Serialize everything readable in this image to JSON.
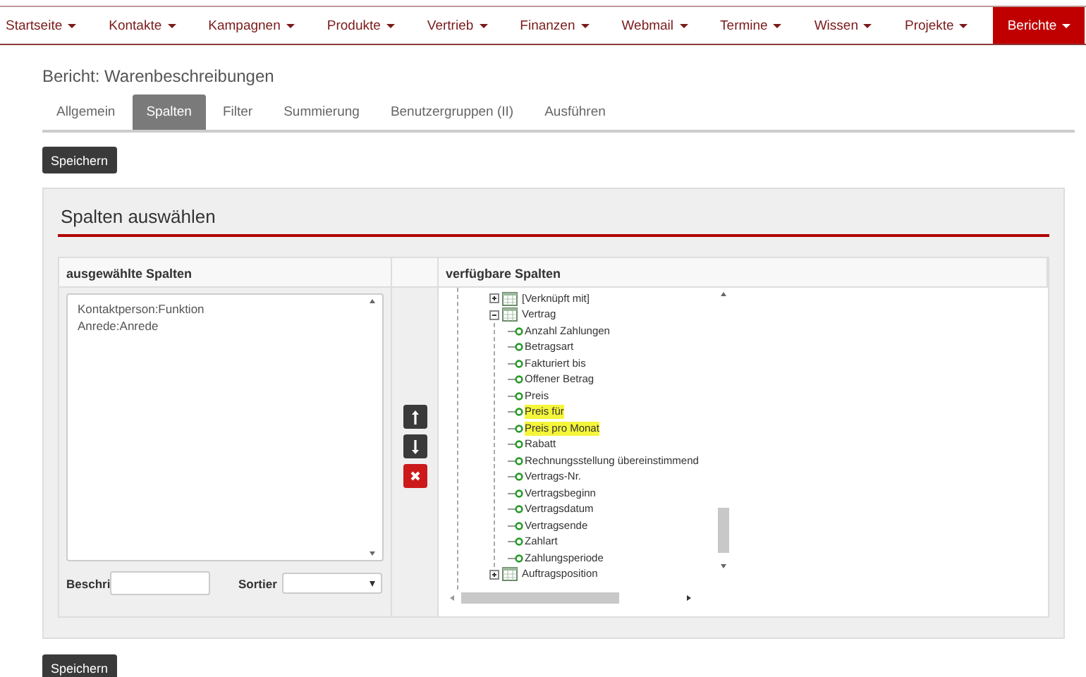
{
  "nav": [
    {
      "label": "Startseite",
      "selected": false
    },
    {
      "label": "Kontakte",
      "selected": false
    },
    {
      "label": "Kampagnen",
      "selected": false
    },
    {
      "label": "Produkte",
      "selected": false
    },
    {
      "label": "Vertrieb",
      "selected": false
    },
    {
      "label": "Finanzen",
      "selected": false
    },
    {
      "label": "Webmail",
      "selected": false
    },
    {
      "label": "Termine",
      "selected": false
    },
    {
      "label": "Wissen",
      "selected": false
    },
    {
      "label": "Projekte",
      "selected": false
    },
    {
      "label": "Berichte",
      "selected": true
    }
  ],
  "page_title": "Bericht: Warenbeschreibungen",
  "tabs": [
    {
      "label": "Allgemein",
      "selected": false
    },
    {
      "label": "Spalten",
      "selected": true
    },
    {
      "label": "Filter",
      "selected": false
    },
    {
      "label": "Summierung",
      "selected": false
    },
    {
      "label": "Benutzergruppen (II)",
      "selected": false
    },
    {
      "label": "Ausführen",
      "selected": false
    }
  ],
  "save_button_top": "Speichern",
  "panel": {
    "title": "Spalten auswählen",
    "selected_header": "ausgewählte Spalten",
    "available_header": "verfügbare Spalten",
    "selected_columns": [
      "Kontaktperson:Funktion",
      "Anrede:Anrede"
    ],
    "caption_label": "Beschri",
    "sort_label": "Sortier",
    "tree": [
      {
        "kind": "folder",
        "label": "[Verknüpft mit]",
        "expanded": false
      },
      {
        "kind": "folder",
        "label": "Vertrag",
        "expanded": true,
        "children": [
          {
            "kind": "field",
            "label": "Anzahl Zahlungen",
            "highlighted": false
          },
          {
            "kind": "field",
            "label": "Betragsart",
            "highlighted": false
          },
          {
            "kind": "field",
            "label": "Fakturiert bis",
            "highlighted": false
          },
          {
            "kind": "field",
            "label": "Offener Betrag",
            "highlighted": false
          },
          {
            "kind": "field",
            "label": "Preis",
            "highlighted": false
          },
          {
            "kind": "field",
            "label": "Preis für",
            "highlighted": true
          },
          {
            "kind": "field",
            "label": "Preis pro Monat",
            "highlighted": true
          },
          {
            "kind": "field",
            "label": "Rabatt",
            "highlighted": false
          },
          {
            "kind": "field",
            "label": "Rechnungsstellung übereinstimmend",
            "highlighted": false
          },
          {
            "kind": "field",
            "label": "Vertrags-Nr.",
            "highlighted": false
          },
          {
            "kind": "field",
            "label": "Vertragsbeginn",
            "highlighted": false
          },
          {
            "kind": "field",
            "label": "Vertragsdatum",
            "highlighted": false
          },
          {
            "kind": "field",
            "label": "Vertragsende",
            "highlighted": false
          },
          {
            "kind": "field",
            "label": "Zahlart",
            "highlighted": false
          },
          {
            "kind": "field",
            "label": "Zahlungsperiode",
            "highlighted": false
          }
        ]
      },
      {
        "kind": "folder",
        "label": "Auftragsposition",
        "expanded": false
      }
    ]
  },
  "save_button_bottom": "Speichern"
}
